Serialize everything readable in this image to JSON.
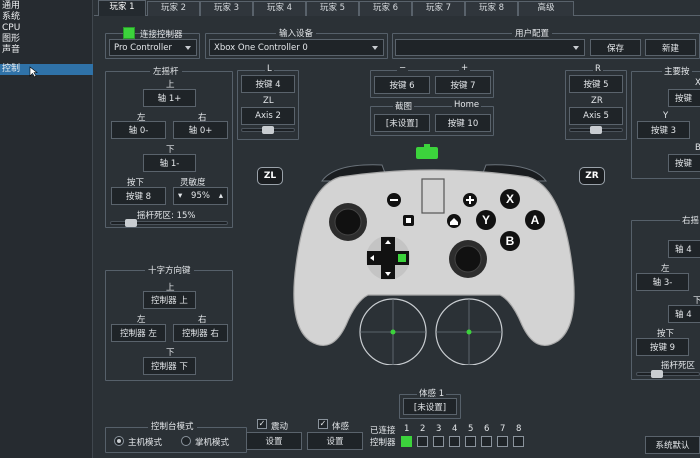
{
  "sidebar": {
    "items": [
      "通用",
      "系统",
      "CPU",
      "图形",
      "声音",
      "控制"
    ],
    "active": "控制"
  },
  "tabs": {
    "items": [
      "玩家 1",
      "玩家 2",
      "玩家 3",
      "玩家 4",
      "玩家 5",
      "玩家 6",
      "玩家 7",
      "玩家 8",
      "高级"
    ],
    "active": "玩家 1"
  },
  "connect": {
    "label": "连接控制器",
    "type_value": "Pro Controller"
  },
  "input_device": {
    "title": "输入设备",
    "value": "Xbox One Controller 0"
  },
  "user_config": {
    "title": "用户配置",
    "value": "",
    "save": "保存",
    "new": "新建"
  },
  "left_stick": {
    "title": "左摇杆",
    "up_label": "上",
    "up": "轴 1+",
    "left_label": "左",
    "left": "轴 0-",
    "right_label": "右",
    "right": "轴 0+",
    "down_label": "下",
    "down": "轴 1-",
    "press_label": "按下",
    "press": "按键 8",
    "sensitivity_label": "灵敏度",
    "sensitivity": "95%",
    "deadzone": "摇杆死区: 15%"
  },
  "l_group": {
    "l_label": "L",
    "l": "按键 4",
    "zl_label": "ZL",
    "zl": "Axis 2"
  },
  "minus_plus": {
    "minus_label": "−",
    "minus": "按键 6",
    "plus_label": "+",
    "plus": "按键 7"
  },
  "capture_home": {
    "capture_label": "截图",
    "capture": "[未设置]",
    "home_label": "Home",
    "home": "按键 10"
  },
  "r_group": {
    "r_label": "R",
    "r": "按键 5",
    "zr_label": "ZR",
    "zr": "Axis 5"
  },
  "main_buttons": {
    "title": "主要按",
    "x_label": "X",
    "x": "按键",
    "y_label": "Y",
    "y": "按键 3",
    "b_label": "B",
    "b": "按键"
  },
  "right_stick": {
    "title": "右摇",
    "up": "轴 4",
    "left_label": "左",
    "left": "轴 3-",
    "down_label": "下",
    "down": "轴 4",
    "press_label": "按下",
    "press": "按键 9",
    "deadzone": "摇杆死区"
  },
  "dpad": {
    "title": "十字方向键",
    "up_label": "上",
    "up": "控制器 上",
    "left_label": "左",
    "left": "控制器 左",
    "right_label": "右",
    "right": "控制器 右",
    "down_label": "下",
    "down": "控制器 下"
  },
  "badges": {
    "zl": "ZL",
    "zr": "ZR"
  },
  "controller_face": {
    "x": "X",
    "y": "Y",
    "a": "A",
    "b": "B"
  },
  "motion": {
    "title": "体感 1",
    "value": "[未设置]"
  },
  "console_mode": {
    "title": "控制台模式",
    "handheld": "主机模式",
    "docked": "掌机模式",
    "selected": "主机模式"
  },
  "vibration": {
    "label": "震动",
    "checked": true,
    "config": "设置"
  },
  "motion_toggle": {
    "label": "体感",
    "checked": true,
    "config": "设置"
  },
  "connected": {
    "label": "已连接",
    "row_label": "控制器",
    "players": [
      "1",
      "2",
      "3",
      "4",
      "5",
      "6",
      "7",
      "8"
    ],
    "on": [
      "1"
    ]
  },
  "defaults": {
    "label": "系统默认"
  },
  "colors": {
    "accent": "#2f72a8",
    "indicator": "#3cd33c"
  }
}
